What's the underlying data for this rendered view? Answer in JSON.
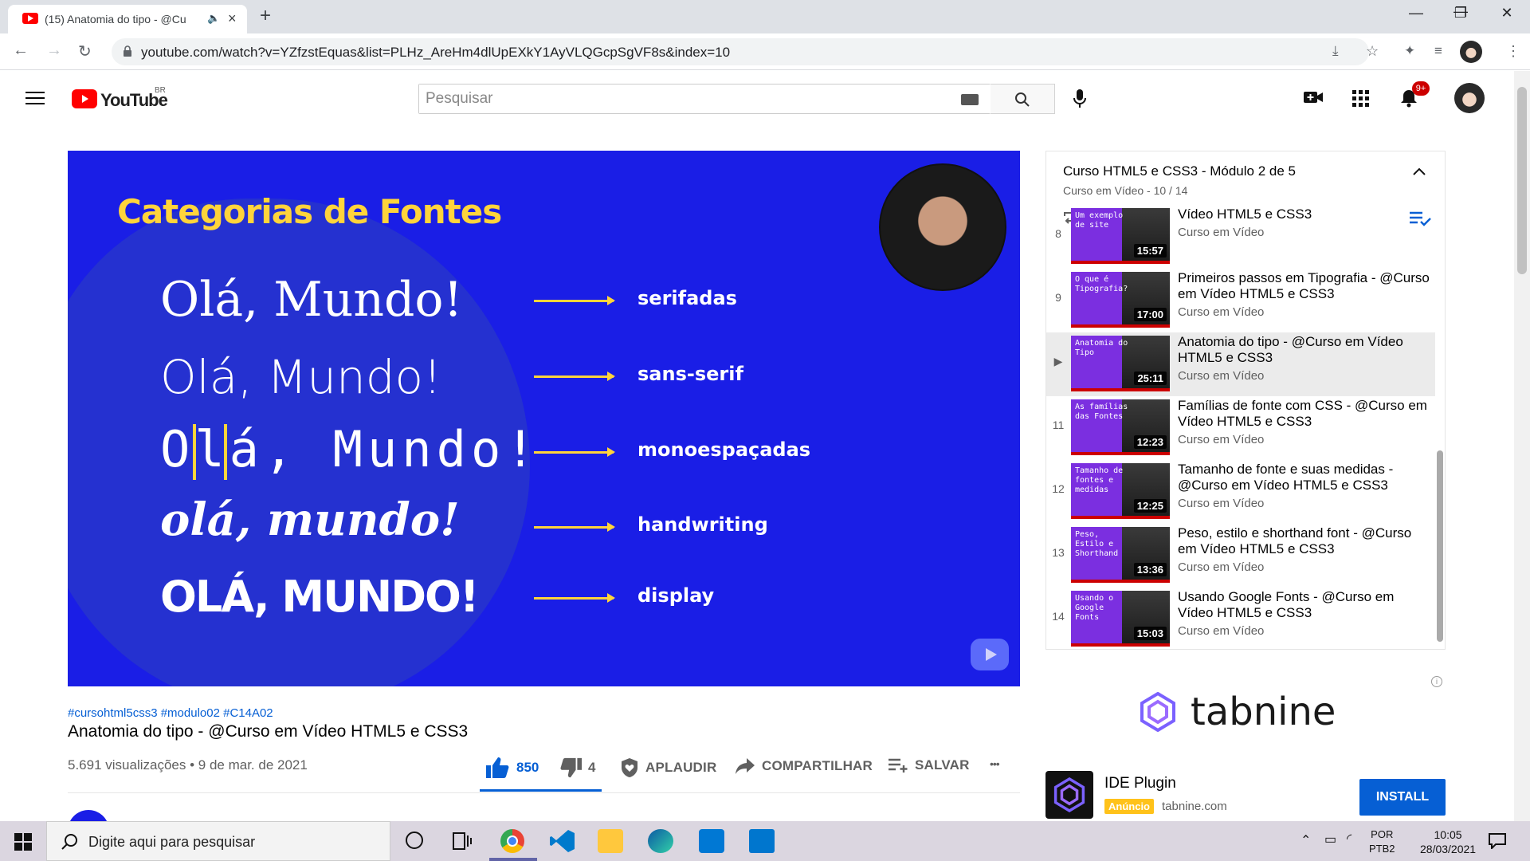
{
  "browser": {
    "tab_title": "(15) Anatomia do tipo - @Cu",
    "url": "youtube.com/watch?v=YZfzstEquas&list=PLHz_AreHm4dlUpEXkY1AyVLQGcpSgVF8s&index=10",
    "new_tab": "+",
    "window_minimize": "—",
    "window_restore": "❐",
    "window_close": "✕"
  },
  "youtube": {
    "logo_text": "YouTube",
    "logo_region": "BR",
    "search_placeholder": "Pesquisar",
    "notifications": "9+",
    "colors": {
      "brand": "#ff0000",
      "accent": "#065fd4"
    }
  },
  "video": {
    "slide_title": "Categorias de Fontes",
    "rows": [
      {
        "sample": "Olá, Mundo!",
        "label": "serifadas"
      },
      {
        "sample": "Olá, Mundo!",
        "label": "sans-serif"
      },
      {
        "sample": "Olá, Mundo!",
        "label": "monoespaçadas"
      },
      {
        "sample": "olá, mundo!",
        "label": "handwriting"
      },
      {
        "sample": "OLÁ, MUNDO!",
        "label": "display"
      }
    ],
    "hashtags": "#cursohtml5css3 #modulo02 #C14A02",
    "title": "Anatomia do tipo - @Curso em Vídeo HTML5 e CSS3",
    "views": "5.691 visualizações • 9 de mar. de 2021",
    "likes": "850",
    "dislikes": "4",
    "applaud": "APLAUDIR",
    "share": "COMPARTILHAR",
    "save": "SALVAR",
    "more": "•••"
  },
  "playlist": {
    "title": "Curso HTML5 e CSS3 - Módulo 2 de 5",
    "subtitle": "Curso em Vídeo - 10 / 14",
    "items": [
      {
        "num": "8",
        "thumb": "Um exemplo de site",
        "duration": "15:57",
        "title": "Vídeo HTML5 e CSS3",
        "channel": "Curso em Vídeo"
      },
      {
        "num": "9",
        "thumb": "O que é Tipografia?",
        "duration": "17:00",
        "title": "Primeiros passos em Tipografia - @Curso em Vídeo HTML5 e CSS3",
        "channel": "Curso em Vídeo"
      },
      {
        "num": "▶",
        "thumb": "Anatomia do Tipo",
        "duration": "25:11",
        "title": "Anatomia do tipo - @Curso em Vídeo HTML5 e CSS3",
        "channel": "Curso em Vídeo"
      },
      {
        "num": "11",
        "thumb": "As famílias das Fontes",
        "duration": "12:23",
        "title": "Famílias de fonte com CSS - @Curso em Vídeo HTML5 e CSS3",
        "channel": "Curso em Vídeo"
      },
      {
        "num": "12",
        "thumb": "Tamanho de fontes e medidas",
        "duration": "12:25",
        "title": "Tamanho de fonte e suas medidas - @Curso em Vídeo HTML5 e CSS3",
        "channel": "Curso em Vídeo"
      },
      {
        "num": "13",
        "thumb": "Peso, Estilo e Shorthand",
        "duration": "13:36",
        "title": "Peso, estilo e shorthand font - @Curso em Vídeo HTML5 e CSS3",
        "channel": "Curso em Vídeo"
      },
      {
        "num": "14",
        "thumb": "Usando o Google Fonts",
        "duration": "15:03",
        "title": "Usando Google Fonts - @Curso em Vídeo HTML5 e CSS3",
        "channel": "Curso em Vídeo"
      }
    ]
  },
  "ad": {
    "brand": "tabnine",
    "title": "IDE Plugin",
    "badge": "Anúncio",
    "domain": "tabnine.com",
    "cta": "INSTALL",
    "info": "i"
  },
  "taskbar": {
    "search_placeholder": "Digite aqui para pesquisar",
    "lang_top": "POR",
    "lang_bottom": "PTB2",
    "time": "10:05",
    "date": "28/03/2021"
  }
}
